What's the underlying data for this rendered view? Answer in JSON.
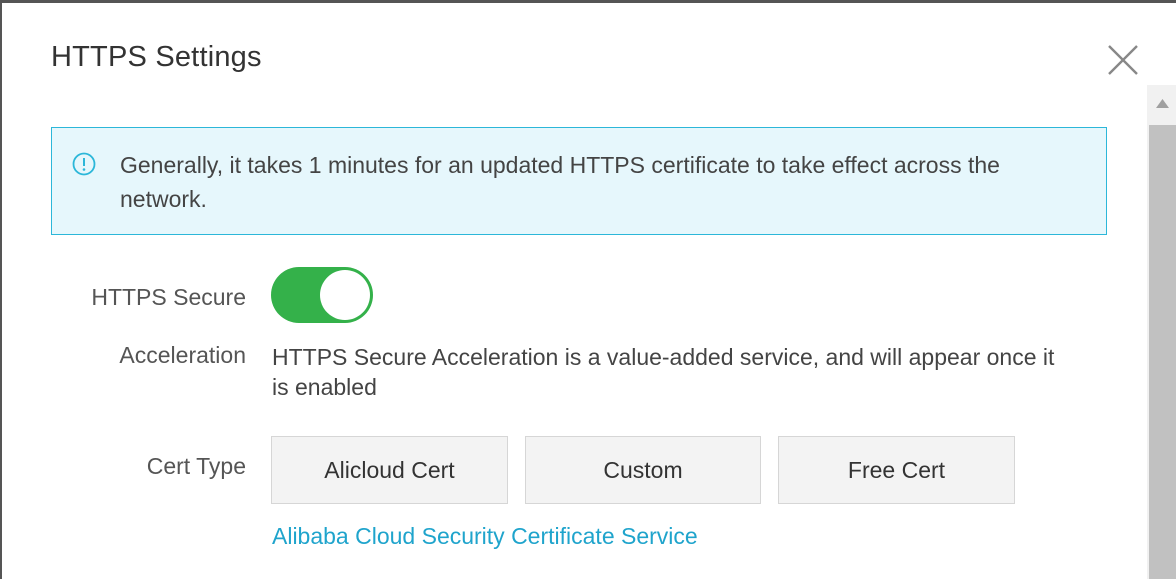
{
  "dialog": {
    "title": "HTTPS Settings",
    "close_icon": "close-icon"
  },
  "notice": {
    "icon": "info-circle-icon",
    "text": "Generally, it takes 1 minutes for an updated HTTPS certificate to take effect across the network."
  },
  "https_secure_acceleration": {
    "label_line1": "HTTPS Secure",
    "label_line2": "Acceleration",
    "enabled": true,
    "description": "HTTPS Secure Acceleration is a value-added service, and will appear once it is enabled"
  },
  "cert_type": {
    "label": "Cert Type",
    "options": [
      "Alicloud Cert",
      "Custom",
      "Free Cert"
    ],
    "link_text": "Alibaba Cloud Security Certificate Service"
  },
  "colors": {
    "toggle_on": "#34b14a",
    "notice_border": "#2cb7d9",
    "notice_bg": "#e6f7fc",
    "link": "#1fa4cc"
  }
}
